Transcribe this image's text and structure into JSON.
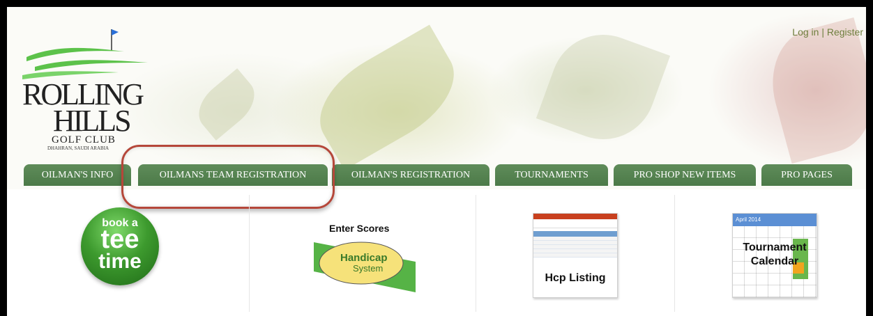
{
  "logo": {
    "line1": "ROLLING",
    "line2": "HILLS",
    "line3": "GOLF CLUB",
    "line4": "DHAHRAN, SAUDI ARABIA"
  },
  "auth": {
    "login": "Log in",
    "separator": "|",
    "register": "Register"
  },
  "nav": {
    "tabs": [
      {
        "label": "OILMAN'S INFO"
      },
      {
        "label": "OILMANS TEAM REGISTRATION"
      },
      {
        "label": "OILMAN'S REGISTRATION"
      },
      {
        "label": "TOURNAMENTS"
      },
      {
        "label": "PRO SHOP NEW ITEMS"
      },
      {
        "label": "PRO PAGES"
      }
    ]
  },
  "panels": {
    "tee": {
      "line1": "book a",
      "line2": "tee",
      "line3": "time"
    },
    "handicap": {
      "title": "Enter Scores",
      "badge_line1": "Handicap",
      "badge_line2": "System"
    },
    "hcp": {
      "label": "Hcp Listing"
    },
    "calendar": {
      "month": "April 2014",
      "line1": "Tournament",
      "line2": "Calendar"
    }
  },
  "colors": {
    "nav_green": "#4c7a48",
    "link_green": "#6f7f3e",
    "highlight_red": "#b5473a",
    "ball_green": "#3d9a2e"
  }
}
